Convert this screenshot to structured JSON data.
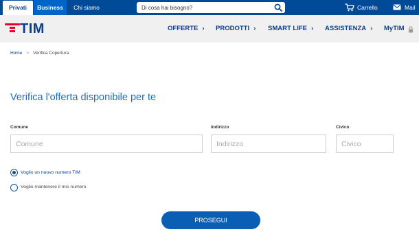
{
  "topbar": {
    "segments": [
      "Privati",
      "Business",
      "Chi siamo"
    ],
    "search_placeholder": "Di cosa hai bisogno?",
    "cart_label": "Carrello",
    "mail_label": "Mail"
  },
  "navbar": {
    "logo_text": "TIM",
    "links": [
      "OFFERTE",
      "PRODOTTI",
      "SMART LIFE",
      "ASSISTENZA"
    ],
    "chevron": "›",
    "account_label": "MyTIM"
  },
  "breadcrumb": {
    "home": "Home",
    "separator": ">",
    "current": "Verifica Copertura"
  },
  "page": {
    "title": "Verifica l'offerta disponibile per te"
  },
  "form": {
    "comune": {
      "label": "Comune",
      "placeholder": "Comune",
      "value": ""
    },
    "indirizzo": {
      "label": "Indirizzo",
      "placeholder": "Indirizzo",
      "value": ""
    },
    "civico": {
      "label": "Civico",
      "placeholder": "Civico",
      "value": ""
    },
    "options": [
      {
        "label": "Voglio un nuovo numero TIM",
        "selected": true
      },
      {
        "label": "Voglio mantenere il mio numero",
        "selected": false
      }
    ],
    "submit_label": "PROSEGUI"
  },
  "colors": {
    "topbar_bg": "#004a98",
    "accent_blue": "#1a6fc2",
    "button_blue": "#0a5fb4",
    "logo_red": "#e4002b",
    "nav_bg": "#f0f0f0"
  }
}
